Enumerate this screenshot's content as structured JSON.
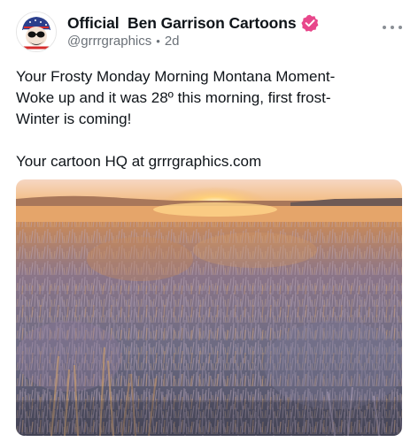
{
  "author": {
    "display_name": "Official  Ben Garrison Cartoons",
    "handle": "@grrrgraphics",
    "separator": "•",
    "time_ago": "2d",
    "avatar_icon": "cartoon-avatar-icon",
    "verified_icon": "verified-badge-icon",
    "verified_color": "#e8478b"
  },
  "post": {
    "lines": [
      "Your Frosty Monday Morning Montana Moment-",
      "Woke up and it was 28º this morning, first frost-",
      "Winter is coming!",
      "Your cartoon HQ at grrrgraphics.com"
    ]
  },
  "media": {
    "description_icon": "sunrise-frosty-sagebrush-photo"
  },
  "actions": {
    "more_icon": "more-options-icon"
  }
}
